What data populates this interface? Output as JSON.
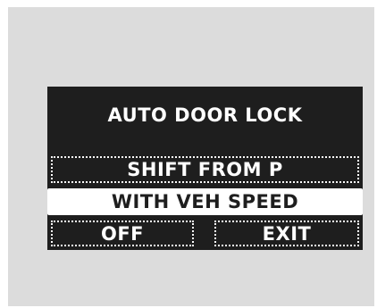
{
  "menu": {
    "title": "AUTO DOOR LOCK",
    "options": {
      "shift_from_p": "SHIFT FROM P",
      "with_veh_speed": "WITH VEH SPEED",
      "off": "OFF",
      "exit": "EXIT"
    },
    "selected": "WITH VEH SPEED"
  },
  "colors": {
    "background": "#dcdcdc",
    "screen": "#1e1e1e",
    "text": "#ffffff"
  }
}
